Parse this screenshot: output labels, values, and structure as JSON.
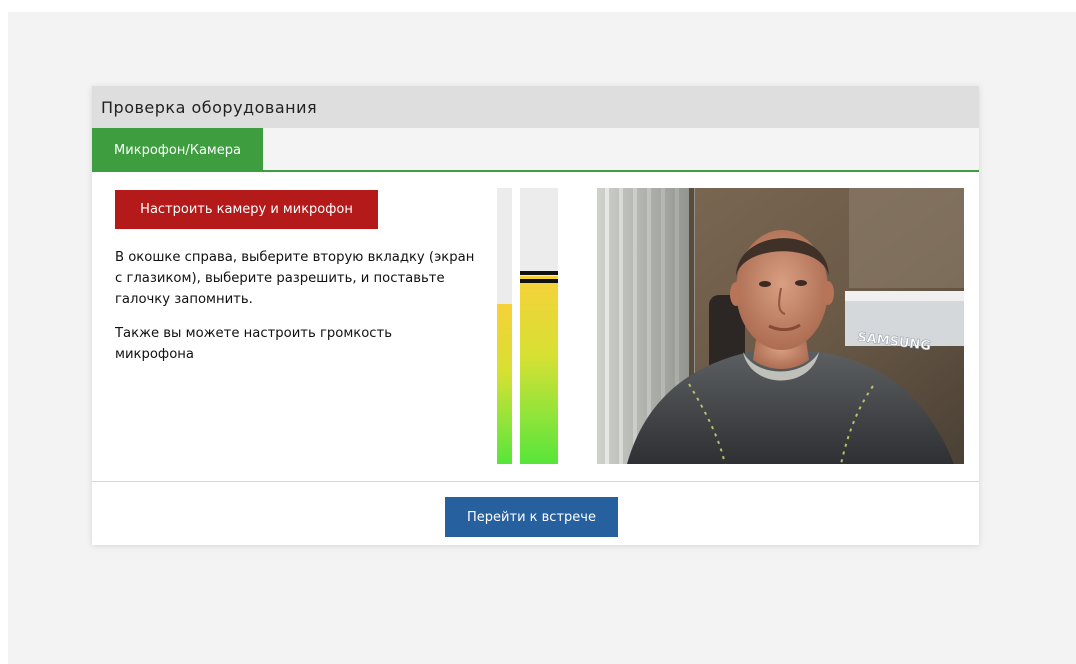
{
  "dialog": {
    "title": "Проверка оборудования"
  },
  "tabs": [
    {
      "label": "Микрофон/Камера",
      "active": true
    }
  ],
  "mic_camera": {
    "setup_button_label": "Настроить камеру и микрофон",
    "instruction_text": "В окошке справа, выберите вторую вкладку (экран с глазиком), выберите разрешить, и поставьте галочку запомнить.",
    "volume_text": "Также вы можете настроить громкость микрофона",
    "level_meters": {
      "left_level": 0.58,
      "right_level": 0.68,
      "right_peak": 0.7
    },
    "video_preview": {
      "visible_text": "SAMSUNG"
    }
  },
  "footer": {
    "join_button_label": "Перейти к встрече"
  },
  "colors": {
    "tab_active": "#3e9e3f",
    "setup_button": "#b51a1a",
    "join_button": "#26609f",
    "meter_top": "#f6d13a",
    "meter_bottom": "#57e53a"
  }
}
